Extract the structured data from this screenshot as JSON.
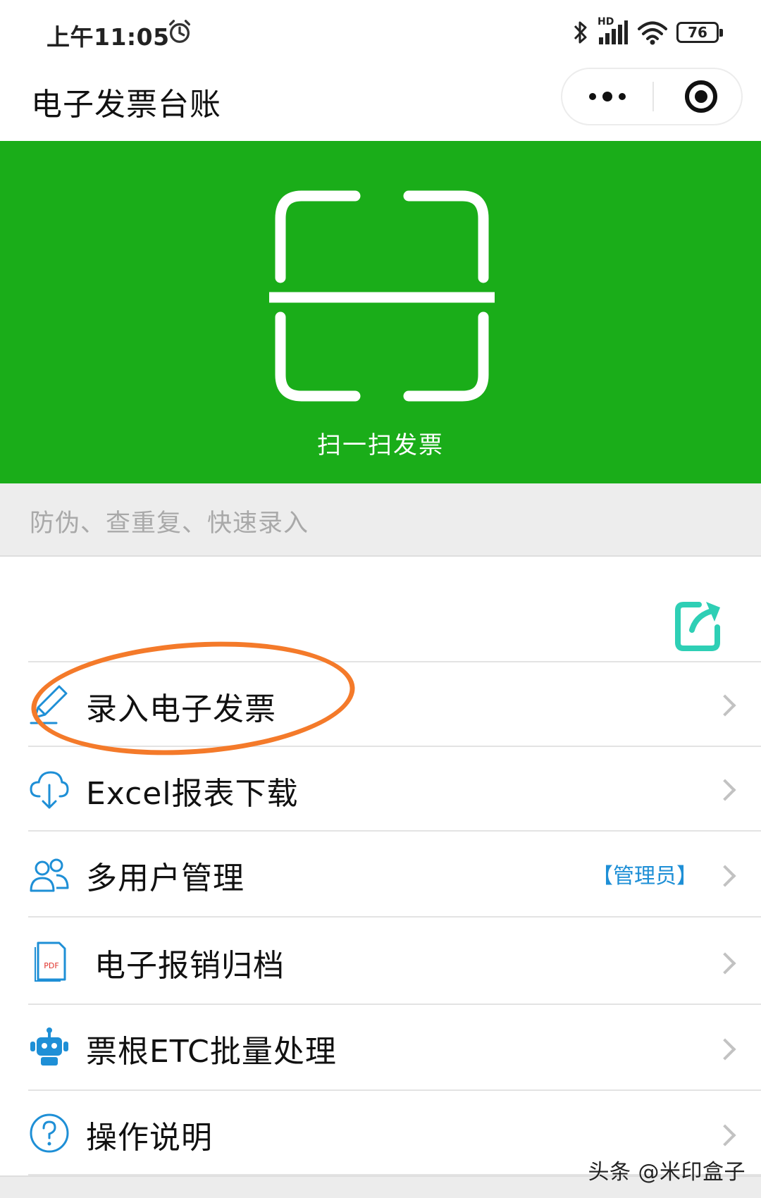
{
  "status_bar": {
    "time": "上午11:05",
    "network_label": "HD",
    "battery": "76"
  },
  "header": {
    "title": "电子发票台账"
  },
  "scan": {
    "label": "扫一扫发票",
    "bg_color": "#1aad19"
  },
  "hint": {
    "text": "防伪、查重复、快速录入"
  },
  "menu": {
    "items": [
      {
        "label": "录入电子发票",
        "icon": "pencil-icon"
      },
      {
        "label": "Excel报表下载",
        "icon": "cloud-download-icon"
      },
      {
        "label": "多用户管理",
        "icon": "users-icon",
        "badge": "【管理员】"
      },
      {
        "label": "电子报销归档",
        "icon": "pdf-file-icon"
      },
      {
        "label": "票根ETC批量处理",
        "icon": "robot-icon"
      },
      {
        "label": "操作说明",
        "icon": "help-circle-icon"
      }
    ]
  },
  "watermark": "头条 @米印盒子",
  "colors": {
    "accent_green": "#1aad19",
    "icon_blue": "#1e8fd6",
    "share_teal": "#2ecfb5",
    "highlight_orange": "#f47a2a"
  }
}
